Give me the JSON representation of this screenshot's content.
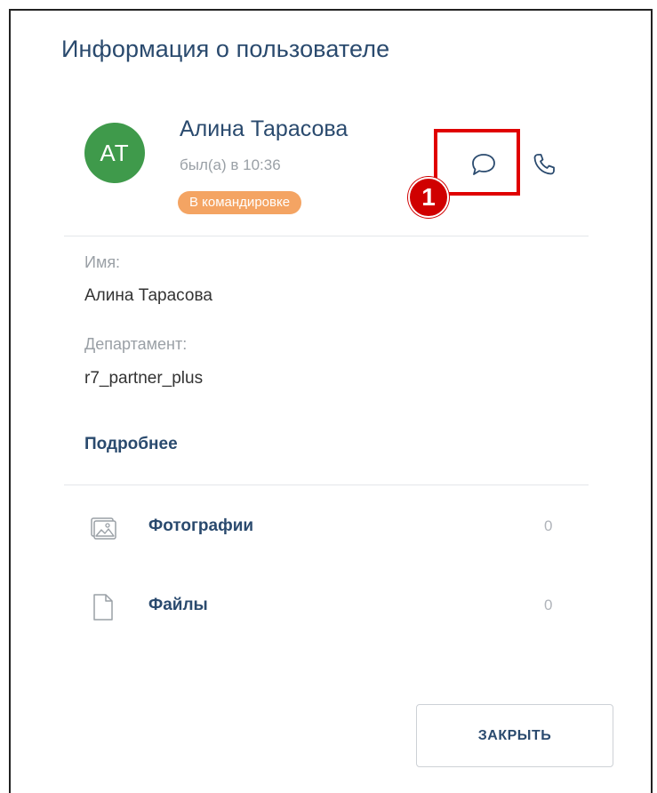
{
  "dialog": {
    "title": "Информация о пользователе"
  },
  "user": {
    "initials": "АТ",
    "name": "Алина Тарасова",
    "last_seen": "был(а) в 10:36",
    "status_badge": "В командировке",
    "avatar_color": "#3f9a4b",
    "badge_color": "#f4a463"
  },
  "actions": {
    "chat_icon": "chat-bubble-icon",
    "call_icon": "phone-icon"
  },
  "annotation": {
    "marker_label": "1",
    "color": "#e00000"
  },
  "fields": [
    {
      "label": "Имя:",
      "value": "Алина Тарасова"
    },
    {
      "label": "Департамент:",
      "value": "r7_partner_plus"
    }
  ],
  "more_link": "Подробнее",
  "media": [
    {
      "label": "Фотографии",
      "count": "0",
      "icon": "photos-icon"
    },
    {
      "label": "Файлы",
      "count": "0",
      "icon": "file-icon"
    }
  ],
  "footer": {
    "close_label": "ЗАКРЫТЬ"
  },
  "colors": {
    "heading": "#2a4a6e",
    "muted": "#9aa0a6"
  }
}
